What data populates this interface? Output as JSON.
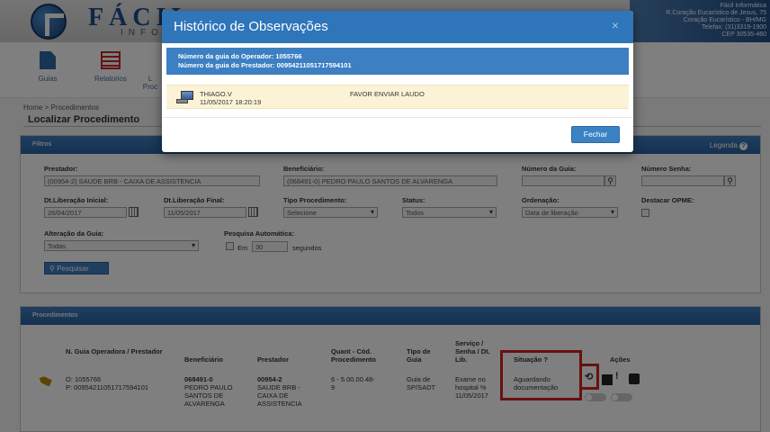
{
  "brand": {
    "name": "FÁCIL",
    "sub": "INFORM"
  },
  "banner": {
    "lines": [
      "Fácil Informática",
      "R.Coração Eucarístico de Jesus, 75",
      "Coração Eucarístico - BH/MG",
      "Telefax: (31)3319-1900",
      "CEP 30535-460"
    ]
  },
  "menu": {
    "items": [
      {
        "label": "Guias"
      },
      {
        "label": "Relatorios"
      },
      {
        "label": "L"
      },
      {
        "label": "Proc"
      }
    ]
  },
  "breadcrumb": "Home > Procedimentos",
  "page_title": "Localizar Procedimento",
  "filtros": {
    "title": "Filtros",
    "legend": "Legenda",
    "prestador_label": "Prestador:",
    "prestador_value": "(00954-2) SAUDE BRB - CAIXA DE ASSISTENCIA",
    "beneficiario_label": "Beneficiário:",
    "beneficiario_value": "(068491-0) PEDRO PAULO SANTOS DE ALVARENGA",
    "numero_guia_label": "Número da Guia:",
    "numero_senha_label": "Número Senha:",
    "dt_inicial_label": "Dt.Liberação Inicial:",
    "dt_inicial_value": "26/04/2017",
    "dt_final_label": "Dt.Liberação Final:",
    "dt_final_value": "11/05/2017",
    "tipo_proc_label": "Tipo Procedimento:",
    "tipo_proc_value": "Selecione",
    "status_label": "Status:",
    "status_value": "Todos",
    "ordenacao_label": "Ordenação:",
    "ordenacao_value": "Data de liberação",
    "destacar_label": "Destacar OPME:",
    "alteracao_label": "Alteração da Guia:",
    "alteracao_value": "Todas",
    "pesquisa_auto_label": "Pesquisa Automática:",
    "em_label": "Em",
    "segundos_value": "30",
    "segundos_label": "segundos",
    "pesquisar": "Pesquisar"
  },
  "procedimentos": {
    "title": "Procedimentos",
    "headers": {
      "guia": "N. Guia Operadora / Prestador",
      "beneficiario": "Beneficiário",
      "prestador": "Prestador",
      "quant": "Quant - Cód. Procedimento",
      "tipo": "Tipo de Guia",
      "servico": "Serviço / Senha / Dt. Lib.",
      "situacao": "Situação ?",
      "acoes": "Ações"
    },
    "row": {
      "guia_o": "O: 1055766",
      "guia_p": "P: 00954211051717594101",
      "benef_1": "068491-0",
      "benef_2": "PEDRO PAULO",
      "benef_3": "SANTOS DE",
      "benef_4": "ALVARENGA",
      "prest_1": "00954-2",
      "prest_2": "SAUDE BRB -",
      "prest_3": "CAIXA DE",
      "prest_4": "ASSISTENCIA",
      "quant_1": "6 - 5.00.00.48-",
      "quant_2": "9",
      "tipo_1": "Guia de",
      "tipo_2": "SP/SADT",
      "serv_1": "Exame no",
      "serv_2": "hospital %",
      "serv_3": "11/05/2017",
      "sit_1": "Aguardando",
      "sit_2": "documentação"
    }
  },
  "modal": {
    "title": "Histórico de Observações",
    "close": "×",
    "guia_operador": "Número da guia do Operador: 1055766",
    "guia_prestador": "Número da guia do Prestador: 00954211051717594101",
    "obs_user": "THIAGO.V",
    "obs_datetime": "11/05/2017 18:20:19",
    "obs_text": "FAVOR ENVIAR LAUDO",
    "fechar": "Fechar"
  },
  "colors": {
    "primary": "#2f75b9",
    "highlight": "#d32020",
    "obs_bg": "#fcf3d6"
  }
}
